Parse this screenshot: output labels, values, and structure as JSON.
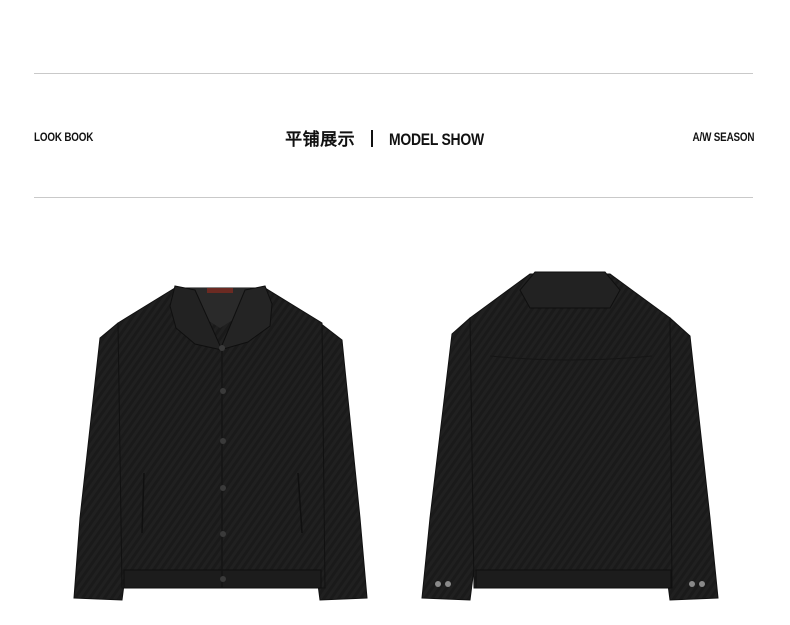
{
  "header": {
    "left_label": "LOOK BOOK",
    "title_cn": "平铺展示",
    "title_en": "MODEL SHOW",
    "right_label": "A/W SEASON"
  },
  "images": [
    {
      "name": "jacket-front",
      "description": "black textured button-front jacket, front view"
    },
    {
      "name": "jacket-back",
      "description": "black textured jacket, back view"
    }
  ],
  "colors": {
    "jacket": "#1f1f1f",
    "jacket_shadow": "#141414",
    "rule": "#c9c9c9",
    "text": "#111111"
  }
}
